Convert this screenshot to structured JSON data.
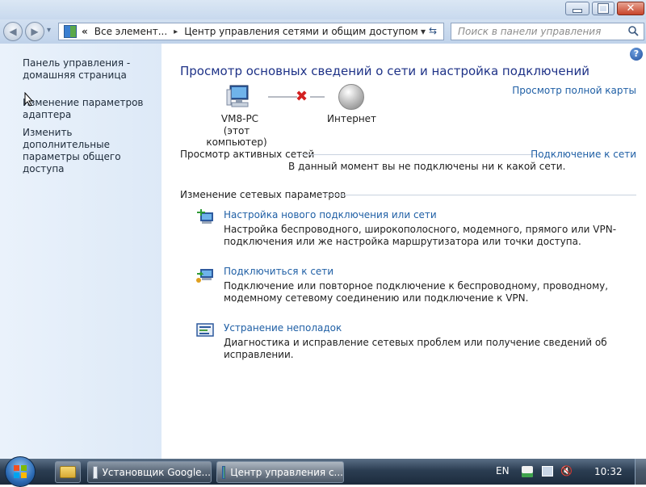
{
  "address": {
    "overflow_glyph": "«",
    "crumb1": "Все элемент...",
    "sep": "▸",
    "crumb2": "Центр управления сетями и общим доступом",
    "dropdown": "▾",
    "refresh": "⇆"
  },
  "search": {
    "placeholder": "Поиск в панели управления"
  },
  "left": {
    "home": "Панель управления - домашняя страница",
    "adapter": "Изменение параметров адаптера",
    "sharing": "Изменить дополнительные параметры общего доступа"
  },
  "main": {
    "heading": "Просмотр основных сведений о сети и настройка подключений",
    "full_map": "Просмотр полной карты",
    "computer_name": "VM8-PC",
    "computer_sub": "(этот компьютер)",
    "internet": "Интернет",
    "active_title": "Просмотр активных сетей",
    "connect_link": "Подключение к сети",
    "not_connected": "В данный момент вы не подключены ни к какой сети.",
    "change_title": "Изменение сетевых параметров",
    "tasks": [
      {
        "title": "Настройка нового подключения или сети",
        "desc": "Настройка беспроводного, широкополосного, модемного, прямого или VPN-подключения или же настройка маршрутизатора или точки доступа."
      },
      {
        "title": "Подключиться к сети",
        "desc": "Подключение или повторное подключение к беспроводному, проводному, модемному сетевому соединению или подключение к VPN."
      },
      {
        "title": "Устранение неполадок",
        "desc": "Диагностика и исправление сетевых проблем или получение сведений об исправлении."
      }
    ]
  },
  "taskbar": {
    "buttons": [
      "Установщик Google...",
      "Центр управления с..."
    ],
    "lang": "EN",
    "time": "10:32"
  }
}
